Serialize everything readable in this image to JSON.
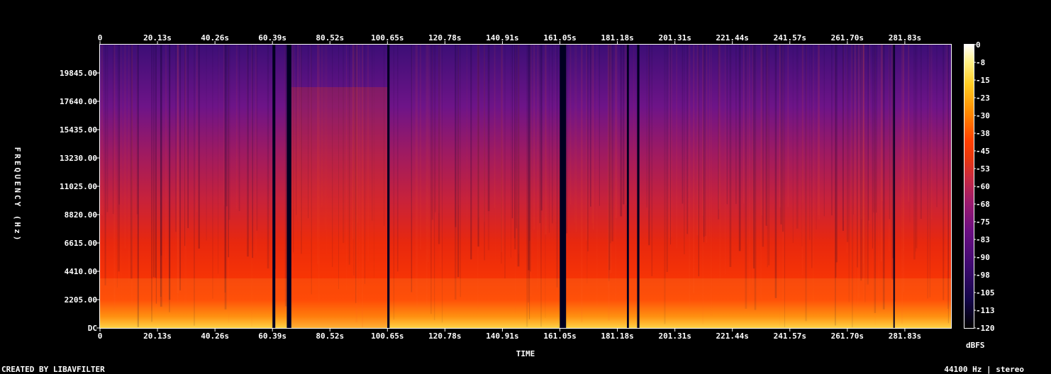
{
  "chart_data": {
    "type": "heatmap",
    "subtype": "spectrogram",
    "xlabel": "TIME",
    "ylabel": "FREQUENCY (Hz)",
    "x_unit": "s",
    "y_unit": "Hz",
    "x_ticks": [
      {
        "value": 0,
        "label": "0"
      },
      {
        "value": 20.13,
        "label": "20.13s"
      },
      {
        "value": 40.26,
        "label": "40.26s"
      },
      {
        "value": 60.39,
        "label": "60.39s"
      },
      {
        "value": 80.52,
        "label": "80.52s"
      },
      {
        "value": 100.65,
        "label": "100.65s"
      },
      {
        "value": 120.78,
        "label": "120.78s"
      },
      {
        "value": 140.91,
        "label": "140.91s"
      },
      {
        "value": 161.05,
        "label": "161.05s"
      },
      {
        "value": 181.18,
        "label": "181.18s"
      },
      {
        "value": 201.31,
        "label": "201.31s"
      },
      {
        "value": 221.44,
        "label": "221.44s"
      },
      {
        "value": 241.57,
        "label": "241.57s"
      },
      {
        "value": 261.7,
        "label": "261.70s"
      },
      {
        "value": 281.83,
        "label": "281.83s"
      }
    ],
    "y_ticks": [
      {
        "value": 0,
        "label": "DC"
      },
      {
        "value": 2205,
        "label": "2205.00"
      },
      {
        "value": 4410,
        "label": "4410.00"
      },
      {
        "value": 6615,
        "label": "6615.00"
      },
      {
        "value": 8820,
        "label": "8820.00"
      },
      {
        "value": 11025,
        "label": "11025.00"
      },
      {
        "value": 13230,
        "label": "13230.00"
      },
      {
        "value": 15435,
        "label": "15435.00"
      },
      {
        "value": 17640,
        "label": "17640.00"
      },
      {
        "value": 19845,
        "label": "19845.00"
      }
    ],
    "xlim": [
      0,
      298
    ],
    "ylim": [
      0,
      22050
    ],
    "colorbar": {
      "label": "dBFS",
      "min": -120,
      "max": 0,
      "ticks": [
        "0",
        "-8",
        "-15",
        "-23",
        "-30",
        "-38",
        "-45",
        "-53",
        "-60",
        "-68",
        "-75",
        "-83",
        "-90",
        "-98",
        "-105",
        "-113",
        "-120"
      ],
      "colors": [
        "#000000",
        "#14064a",
        "#3e0a70",
        "#6a0e82",
        "#9a1a6e",
        "#c82a40",
        "#e8380e",
        "#ff4000",
        "#ff8a00",
        "#ffcc22",
        "#fff28a",
        "#ffffff"
      ]
    },
    "silent_gaps": [
      [
        60.4,
        61.4
      ],
      [
        65.4,
        67.0
      ],
      [
        100.6,
        101.4
      ],
      [
        161.0,
        163.2
      ],
      [
        184.5,
        185.2
      ],
      [
        188.1,
        188.9
      ],
      [
        277.8,
        278.3
      ],
      [
        298.0,
        300.0
      ]
    ],
    "loud_region": [
      67.0,
      100.6
    ]
  },
  "footer": {
    "credit": "CREATED BY LIBAVFILTER",
    "format": "44100 Hz | stereo"
  }
}
